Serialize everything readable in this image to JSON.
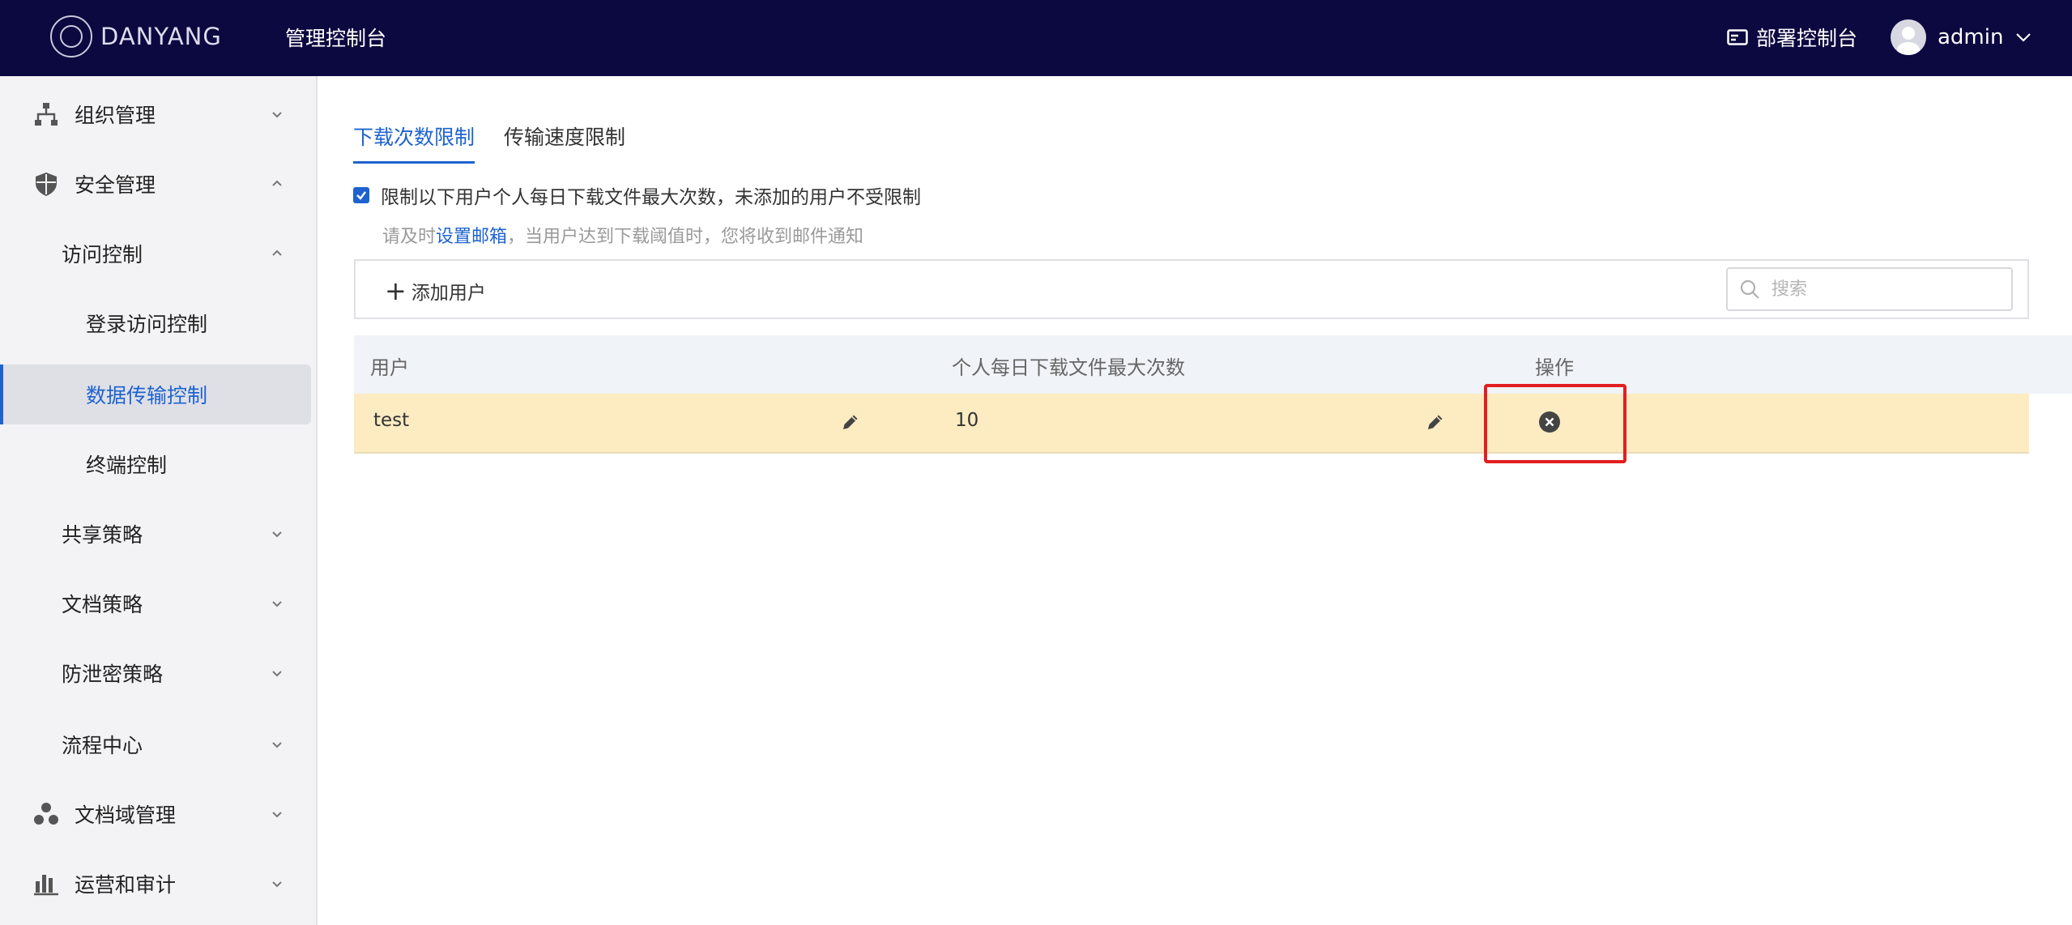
{
  "header": {
    "brand": "DANYANG",
    "console_title": "管理控制台",
    "deploy_label": "部署控制台",
    "user_name": "admin"
  },
  "sidebar": {
    "items": [
      {
        "label": "组织管理",
        "icon": "org-tree-icon",
        "chevron": "down"
      },
      {
        "label": "安全管理",
        "icon": "shield-icon",
        "chevron": "up"
      },
      {
        "label": "访问控制",
        "chevron": "up"
      },
      {
        "label": "登录访问控制"
      },
      {
        "label": "数据传输控制",
        "active": true
      },
      {
        "label": "终端控制"
      },
      {
        "label": "共享策略",
        "chevron": "down"
      },
      {
        "label": "文档策略",
        "chevron": "down"
      },
      {
        "label": "防泄密策略",
        "chevron": "down"
      },
      {
        "label": "流程中心",
        "chevron": "down"
      },
      {
        "label": "文档域管理",
        "icon": "cluster-icon",
        "chevron": "down"
      },
      {
        "label": "运营和审计",
        "icon": "bar-chart-icon",
        "chevron": "down"
      }
    ]
  },
  "main": {
    "tabs": [
      {
        "label": "下载次数限制",
        "active": true
      },
      {
        "label": "传输速度限制"
      }
    ],
    "checkbox_label": "限制以下用户个人每日下载文件最大次数，未添加的用户不受限制",
    "hint_prefix": "请及时",
    "hint_link": "设置邮箱",
    "hint_suffix": "，当用户达到下载阈值时，您将收到邮件通知",
    "add_user_label": "添加用户",
    "search_placeholder": "搜索",
    "table": {
      "headers": [
        "用户",
        "个人每日下载文件最大次数",
        "操作"
      ],
      "rows": [
        {
          "user": "test",
          "max_downloads": "10"
        }
      ]
    }
  },
  "colors": {
    "topbar": "#0c0840",
    "accent": "#1d63d0",
    "row_highlight": "#fdebc2",
    "annotation": "#e21f1f"
  }
}
